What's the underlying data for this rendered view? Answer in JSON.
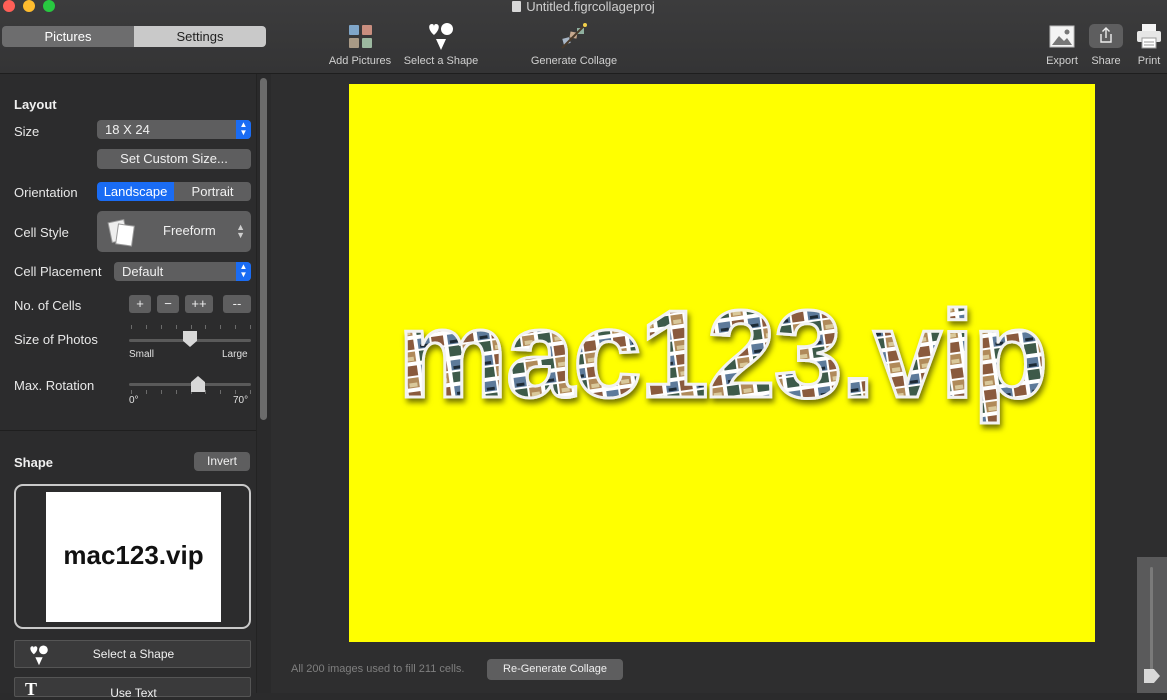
{
  "window": {
    "title": "Untitled.figrcollageproj"
  },
  "top_tabs": {
    "pictures": "Pictures",
    "settings": "Settings"
  },
  "toolbar": {
    "add_pictures": "Add Pictures",
    "select_shape": "Select a Shape",
    "generate_collage": "Generate Collage",
    "export": "Export",
    "share": "Share",
    "print": "Print"
  },
  "layout": {
    "title": "Layout",
    "size_label": "Size",
    "size_value": "18 X 24",
    "custom_size_button": "Set Custom Size...",
    "orientation_label": "Orientation",
    "orientation_options": [
      "Landscape",
      "Portrait"
    ],
    "orientation_selected": "Landscape",
    "cell_style_label": "Cell Style",
    "cell_style_value": "Freeform",
    "cell_placement_label": "Cell Placement",
    "cell_placement_value": "Default",
    "no_cells_label": "No. of Cells",
    "cell_buttons": [
      "+",
      "−",
      "++",
      "--"
    ],
    "size_photos_label": "Size of Photos",
    "size_photos_min": "Small",
    "size_photos_max": "Large",
    "size_photos_level": 0.5,
    "max_rotation_label": "Max. Rotation",
    "max_rotation_min": "0°",
    "max_rotation_max": "70°",
    "max_rotation_level": 0.57
  },
  "shape": {
    "title": "Shape",
    "invert_button": "Invert",
    "preview_text": "mac123.vip",
    "select_shape_button": "Select a Shape",
    "use_text_button": "Use Text"
  },
  "canvas": {
    "background_color": "#ffff00",
    "collage_text": "mac123.vip"
  },
  "status": {
    "message": "All 200 images used to fill 211 cells.",
    "regenerate_button": "Re-Generate Collage"
  },
  "icons": {
    "add_pictures": "photo-grid-icon",
    "select_shape": "heart-spade-triangle-icon",
    "generate_collage": "collage-wand-icon",
    "export": "image-export-icon",
    "share": "share-icon",
    "print": "printer-icon"
  },
  "colors": {
    "accent": "#1a6cf4",
    "poster": "#ffff00"
  }
}
